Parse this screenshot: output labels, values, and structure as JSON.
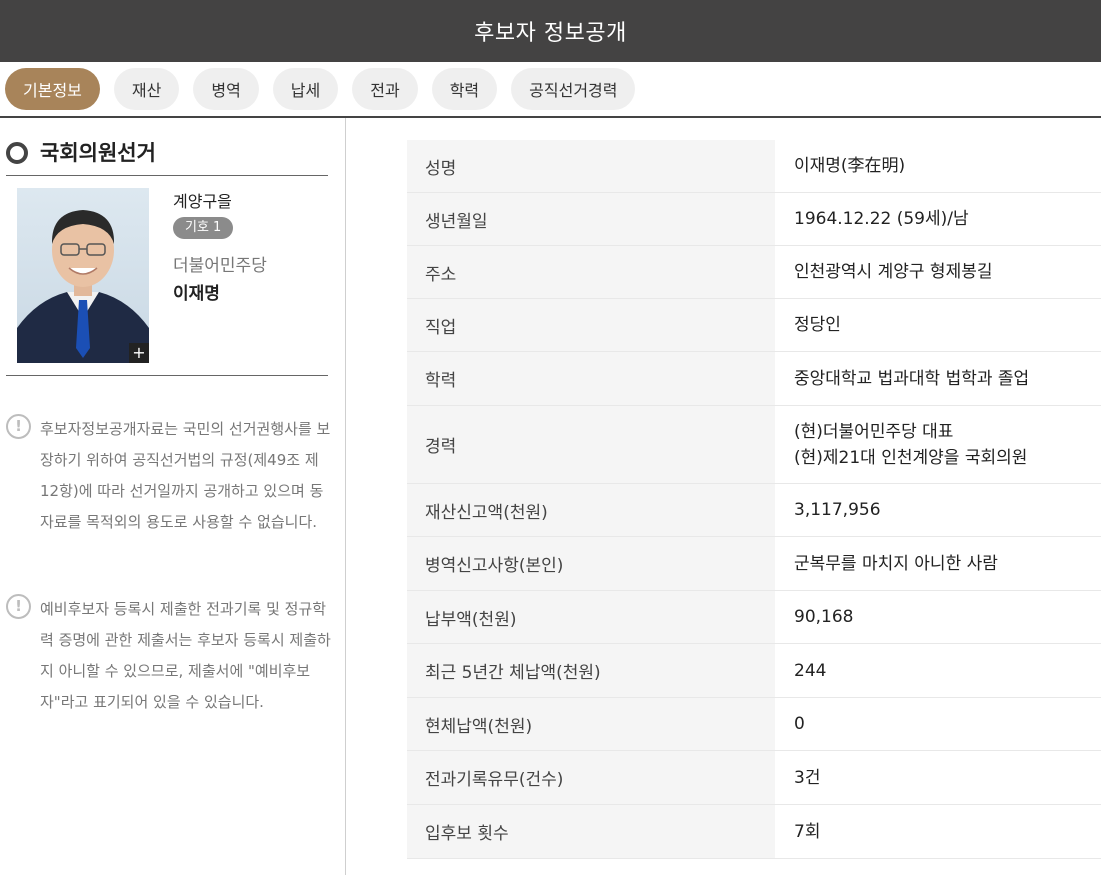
{
  "header": {
    "title": "후보자 정보공개"
  },
  "tabs": [
    {
      "label": "기본정보",
      "active": true
    },
    {
      "label": "재산",
      "active": false
    },
    {
      "label": "병역",
      "active": false
    },
    {
      "label": "납세",
      "active": false
    },
    {
      "label": "전과",
      "active": false
    },
    {
      "label": "학력",
      "active": false
    },
    {
      "label": "공직선거경력",
      "active": false
    }
  ],
  "left": {
    "section_title": "국회의원선거",
    "candidate": {
      "district": "계양구을",
      "number": "기호 1",
      "party": "더불어민주당",
      "name": "이재명",
      "photo_plus": "+"
    },
    "notices": [
      {
        "icon": "!",
        "text": "후보자정보공개자료는 국민의 선거권행사를 보장하기 위하여 공직선거법의 규정(제49조 제12항)에 따라 선거일까지 공개하고 있으며 동 자료를 목적외의 용도로 사용할 수 없습니다."
      },
      {
        "icon": "!",
        "text": "예비후보자 등록시 제출한 전과기록 및 정규학력 증명에 관한 제출서는 후보자 등록시 제출하지 아니할 수 있으므로, 제출서에 \"예비후보자\"라고 표기되어 있을 수 있습니다."
      }
    ]
  },
  "info_table": [
    {
      "label": "성명",
      "values": [
        "이재명(李在明)"
      ]
    },
    {
      "label": "생년월일",
      "values": [
        "1964.12.22 (59세)/남"
      ]
    },
    {
      "label": "주소",
      "values": [
        "인천광역시 계양구 형제봉길"
      ]
    },
    {
      "label": "직업",
      "values": [
        "정당인"
      ]
    },
    {
      "label": "학력",
      "values": [
        "중앙대학교 법과대학 법학과 졸업"
      ]
    },
    {
      "label": "경력",
      "values": [
        "(현)더불어민주당 대표",
        "(현)제21대 인천계양을 국회의원"
      ]
    },
    {
      "label": "재산신고액(천원)",
      "values": [
        "3,117,956"
      ]
    },
    {
      "label": "병역신고사항(본인)",
      "values": [
        "군복무를 마치지 아니한 사람"
      ]
    },
    {
      "label": "납부액(천원)",
      "values": [
        "90,168"
      ]
    },
    {
      "label": "최근 5년간 체납액(천원)",
      "values": [
        "244"
      ]
    },
    {
      "label": "현체납액(천원)",
      "values": [
        "0"
      ]
    },
    {
      "label": "전과기록유무(건수)",
      "values": [
        "3건"
      ]
    },
    {
      "label": "입후보 횟수",
      "values": [
        "7회"
      ]
    }
  ]
}
